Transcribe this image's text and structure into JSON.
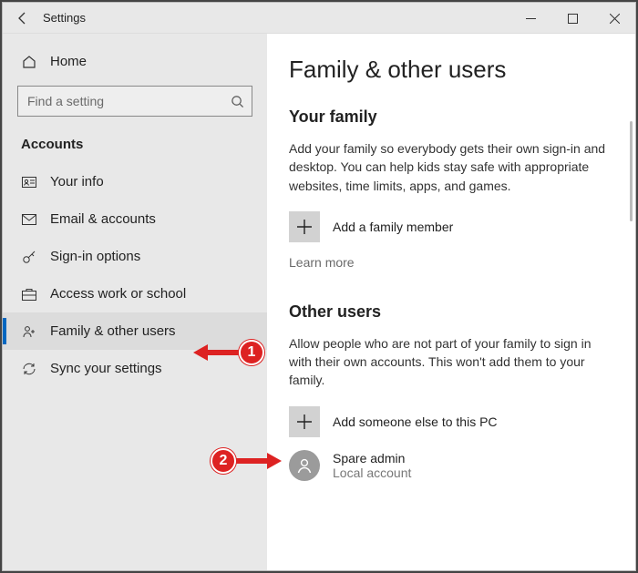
{
  "window": {
    "title": "Settings"
  },
  "sidebar": {
    "home": "Home",
    "search_placeholder": "Find a setting",
    "section": "Accounts",
    "items": [
      {
        "icon": "user-card-icon",
        "label": "Your info"
      },
      {
        "icon": "mail-icon",
        "label": "Email & accounts"
      },
      {
        "icon": "key-icon",
        "label": "Sign-in options"
      },
      {
        "icon": "briefcase-icon",
        "label": "Access work or school"
      },
      {
        "icon": "family-icon",
        "label": "Family & other users"
      },
      {
        "icon": "sync-icon",
        "label": "Sync your settings"
      }
    ],
    "selected_index": 4
  },
  "main": {
    "title": "Family & other users",
    "family": {
      "heading": "Your family",
      "description": "Add your family so everybody gets their own sign-in and desktop. You can help kids stay safe with appropriate websites, time limits, apps, and games.",
      "add_label": "Add a family member",
      "learn_more": "Learn more"
    },
    "other": {
      "heading": "Other users",
      "description": "Allow people who are not part of your family to sign in with their own accounts. This won't add them to your family.",
      "add_label": "Add someone else to this PC",
      "users": [
        {
          "name": "Spare admin",
          "type": "Local account"
        }
      ]
    }
  },
  "annotations": [
    {
      "num": "1"
    },
    {
      "num": "2"
    }
  ]
}
